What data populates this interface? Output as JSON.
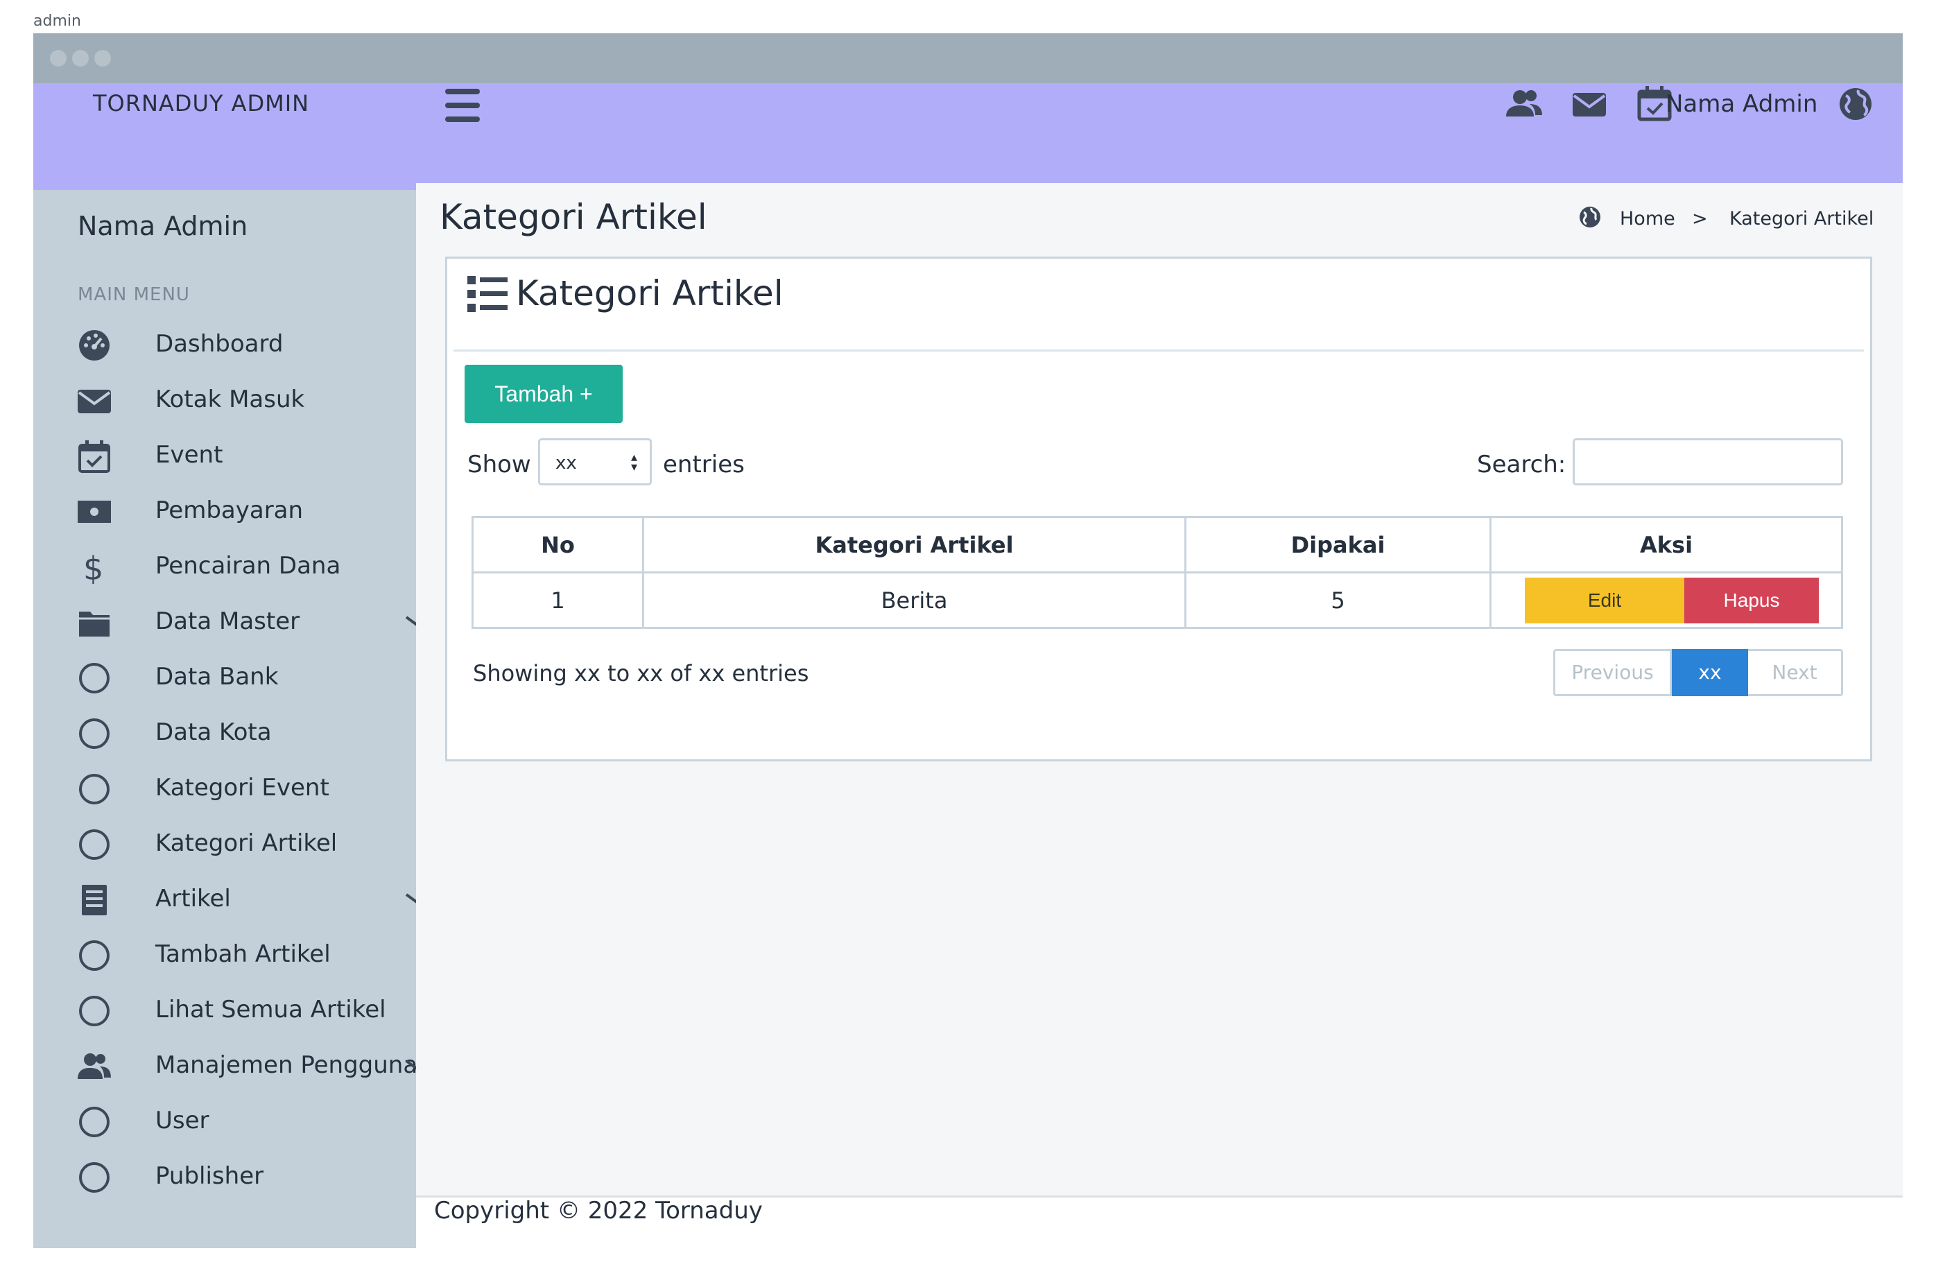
{
  "window": {
    "label": "admin"
  },
  "topbar": {
    "brand": "TORNADUY ADMIN",
    "admin_name": "Nama Admin",
    "icons": [
      "users-icon",
      "mail-icon",
      "calendar-check-icon",
      "globe-icon"
    ]
  },
  "sidebar": {
    "user": "Nama Admin",
    "heading": "MAIN MENU",
    "items": [
      {
        "label": "Dashboard",
        "icon": "dashboard-icon"
      },
      {
        "label": "Kotak Masuk",
        "icon": "mail-icon"
      },
      {
        "label": "Event",
        "icon": "calendar-check-icon"
      },
      {
        "label": "Pembayaran",
        "icon": "money-icon"
      },
      {
        "label": "Pencairan Dana",
        "icon": "dollar-icon"
      },
      {
        "label": "Data Master",
        "icon": "folder-icon",
        "expandable": true
      },
      {
        "label": "Data Bank",
        "icon": "circle-icon"
      },
      {
        "label": "Data Kota",
        "icon": "circle-icon"
      },
      {
        "label": "Kategori Event",
        "icon": "circle-icon"
      },
      {
        "label": "Kategori Artikel",
        "icon": "circle-icon"
      },
      {
        "label": "Artikel",
        "icon": "article-icon",
        "expandable": true
      },
      {
        "label": "Tambah Artikel",
        "icon": "circle-icon"
      },
      {
        "label": "Lihat Semua Artikel",
        "icon": "circle-icon"
      },
      {
        "label": "Manajemen Pengguna",
        "icon": "users-icon",
        "expandable": true
      },
      {
        "label": "User",
        "icon": "circle-icon"
      },
      {
        "label": "Publisher",
        "icon": "circle-icon"
      }
    ]
  },
  "page": {
    "title": "Kategori Artikel",
    "breadcrumb": {
      "home": "Home",
      "separator": ">",
      "current": "Kategori Artikel"
    }
  },
  "card": {
    "title": "Kategori Artikel",
    "add_button": "Tambah +",
    "show_label": "Show",
    "entries_select_value": "xx",
    "entries_label": "entries",
    "search_label": "Search:",
    "search_value": ""
  },
  "table": {
    "columns": [
      "No",
      "Kategori Artikel",
      "Dipakai",
      "Aksi"
    ],
    "rows": [
      {
        "no": "1",
        "kategori": "Berita",
        "dipakai": "5",
        "edit_label": "Edit",
        "delete_label": "Hapus"
      }
    ]
  },
  "pagination": {
    "info": "Showing xx to xx of xx entries",
    "previous": "Previous",
    "current": "xx",
    "next": "Next"
  },
  "footer": {
    "copyright": "Copyright © 2022 Tornaduy"
  },
  "colors": {
    "topbar": "#b1adf8",
    "sidebar": "#c3cfd9",
    "add_button": "#1fae97",
    "edit_button": "#f5c126",
    "delete_button": "#d44255",
    "page_active": "#2a83d6"
  }
}
